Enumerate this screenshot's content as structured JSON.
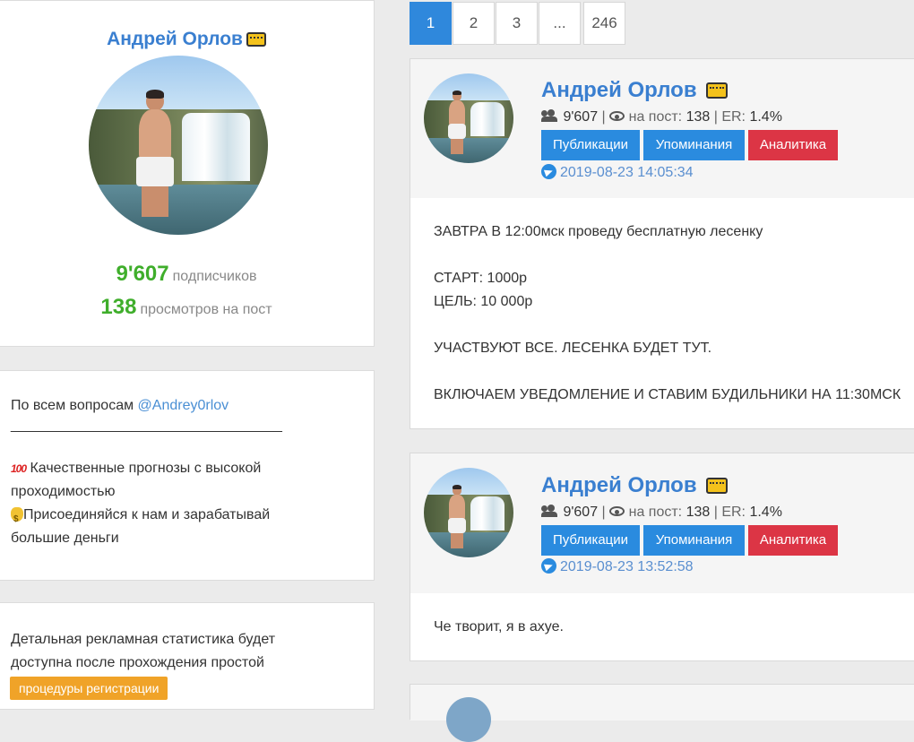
{
  "profile": {
    "name": "Андрей Орлов",
    "subscribers_value": "9'607",
    "subscribers_label": "подписчиков",
    "views_value": "138",
    "views_label": "просмотров на пост"
  },
  "about": {
    "contact_prefix": "По всем вопросам",
    "contact_handle": "@Andrey0rlov",
    "divider": "____________________________________",
    "line1": "Качественные прогнозы с высокой",
    "line1b": "проходимостью",
    "line2": "Присоединяйся к нам и зарабатывай",
    "line2b": "большие деньги"
  },
  "ads": {
    "line1": "Детальная рекламная статистика будет",
    "line2": "доступна после прохождения простой",
    "register_label": "процедуры регистрации"
  },
  "pagination": [
    "1",
    "2",
    "3",
    "...",
    "246"
  ],
  "posts": [
    {
      "name": "Андрей Орлов",
      "subscribers": "9'607",
      "per_post_label": "на пост:",
      "per_post": "138",
      "er_label": "ER:",
      "er": "1.4%",
      "btn_pub": "Публикации",
      "btn_mentions": "Упоминания",
      "btn_analytics": "Аналитика",
      "date": "2019-08-23 14:05:34",
      "lines": [
        "ЗАВТРА В 12:00мск проведу бесплатную лесенку",
        "СТАРТ: 1000р",
        "ЦЕЛЬ: 10 000р",
        "УЧАСТВУЮТ ВСЕ. ЛЕСЕНКА БУДЕТ ТУТ.",
        "ВКЛЮЧАЕМ УВЕДОМЛЕНИЕ И СТАВИМ БУДИЛЬНИКИ НА 11:30МСК"
      ]
    },
    {
      "name": "Андрей Орлов",
      "subscribers": "9'607",
      "per_post_label": "на пост:",
      "per_post": "138",
      "er_label": "ER:",
      "er": "1.4%",
      "btn_pub": "Публикации",
      "btn_mentions": "Упоминания",
      "btn_analytics": "Аналитика",
      "date": "2019-08-23 13:52:58",
      "lines": [
        "Че творит, я в ахуе."
      ]
    }
  ]
}
